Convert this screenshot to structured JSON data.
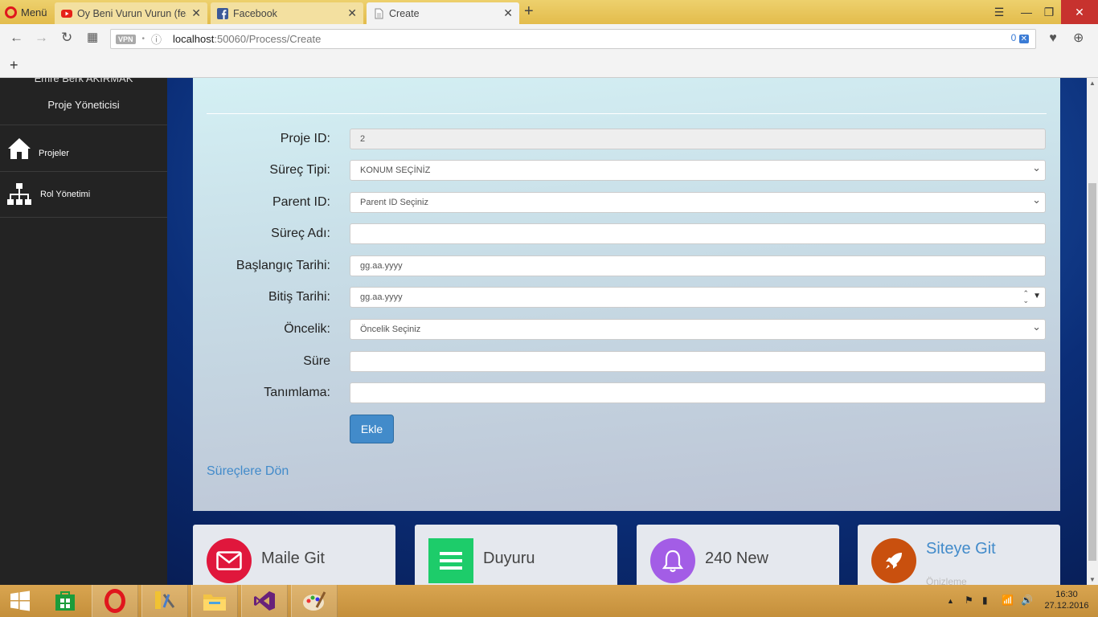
{
  "browser": {
    "menu_label": "Menü",
    "tabs": [
      {
        "title": "Oy Beni Vurun Vurun (feat",
        "favicon": "youtube-icon"
      },
      {
        "title": "Facebook",
        "favicon": "facebook-icon"
      },
      {
        "title": "Create",
        "favicon": "page-icon"
      }
    ],
    "active_tab": 2,
    "vpn_label": "VPN",
    "url_host": "localhost",
    "url_path": ":50060/Process/Create",
    "adblock_count": "0"
  },
  "sidebar": {
    "user_name": "Emre Berk AKIRMAK",
    "user_role": "Proje Yöneticisi",
    "items": [
      {
        "label": "Projeler",
        "icon": "home-icon"
      },
      {
        "label": "Rol Yönetimi",
        "icon": "sitemap-icon"
      }
    ]
  },
  "form": {
    "fields": [
      {
        "label": "Proje ID:",
        "value": "2",
        "type": "readonly"
      },
      {
        "label": "Süreç Tipi:",
        "value": "KONUM SEÇİNİZ",
        "type": "select"
      },
      {
        "label": "Parent ID:",
        "value": "Parent ID Seçiniz",
        "type": "select"
      },
      {
        "label": "Süreç Adı:",
        "value": "",
        "type": "text"
      },
      {
        "label": "Başlangıç Tarihi:",
        "placeholder": "gg.aa.yyyy",
        "type": "date"
      },
      {
        "label": "Bitiş Tarihi:",
        "placeholder": "gg.aa.yyyy",
        "type": "date-spinner"
      },
      {
        "label": "Öncelik:",
        "value": "Öncelik Seçiniz",
        "type": "select"
      },
      {
        "label": "Süre",
        "value": "",
        "type": "text"
      },
      {
        "label": "Tanımlama:",
        "value": "",
        "type": "text"
      }
    ],
    "submit_label": "Ekle",
    "back_link": "Süreçlere Dön"
  },
  "cards": [
    {
      "label": "Maile Git",
      "icon": "envelope-icon",
      "color": "#e0173c"
    },
    {
      "label": "Duyuru",
      "icon": "list-icon",
      "color": "#1dcc6a"
    },
    {
      "label": "240 New",
      "icon": "bell-icon",
      "color": "#a35de6"
    },
    {
      "label": "Siteye Git",
      "sub": "Önizleme",
      "icon": "rocket-icon",
      "color": "#c9500e"
    }
  ],
  "taskbar": {
    "time": "16:30",
    "date": "27.12.2016"
  }
}
